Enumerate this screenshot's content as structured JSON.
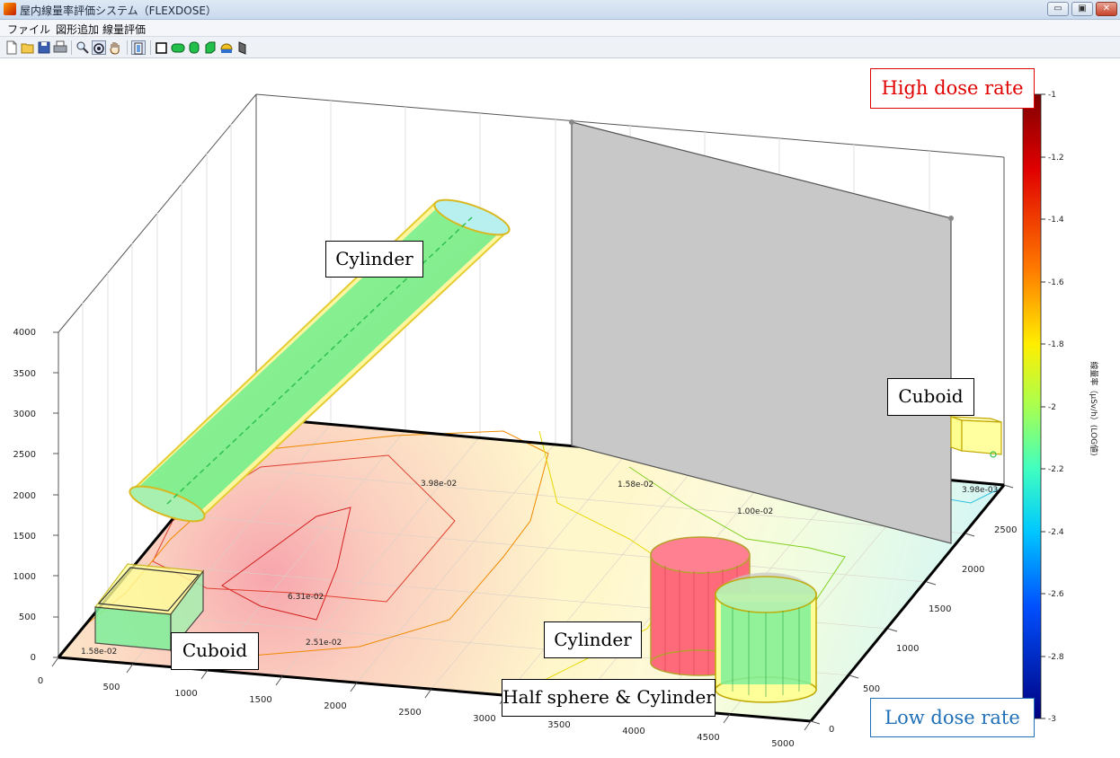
{
  "window": {
    "title": "屋内線量率評価システム（FLEXDOSE）",
    "minimize_glyph": "▭",
    "maximize_glyph": "▣",
    "close_glyph": "✕"
  },
  "menu": {
    "items": [
      "ファイル",
      "図形追加",
      "線量評価"
    ]
  },
  "toolbar": {
    "icons": [
      "new-file-icon",
      "open-folder-icon",
      "save-icon",
      "print-icon",
      "zoom-icon",
      "rotate-3d-icon",
      "pan-hand-icon",
      "legend-toggle-icon",
      "add-cuboid-icon",
      "add-cylinder-icon",
      "add-cylinder-alt-icon",
      "add-cylinder-vertical-icon",
      "add-half-sphere-icon",
      "add-wall-icon"
    ]
  },
  "annotations": {
    "cylinder_top": "Cylinder",
    "cuboid_right": "Cuboid",
    "cuboid_left": "Cuboid",
    "cylinder_bottom": "Cylinder",
    "half_sphere_cylinder": "Half sphere & Cylinder",
    "high_dose": "High dose rate",
    "low_dose": "Low dose rate"
  },
  "axes": {
    "z_ticks": [
      "0",
      "500",
      "1000",
      "1500",
      "2000",
      "2500",
      "3000",
      "3500",
      "4000"
    ],
    "x_ticks": [
      "0",
      "500",
      "1000",
      "1500",
      "2000",
      "2500",
      "3000",
      "3500",
      "4000",
      "4500",
      "5000"
    ],
    "y_ticks": [
      "0",
      "500",
      "1000",
      "1500",
      "2000",
      "2500"
    ]
  },
  "contours": {
    "labels": [
      "6.31e-02",
      "3.98e-02",
      "2.51e-02",
      "1.58e-02",
      "1.58e-02",
      "1.00e-02",
      "3.98e-03"
    ]
  },
  "colorbar": {
    "ticks": [
      "-1",
      "-1.2",
      "-1.4",
      "-1.6",
      "-1.8",
      "-2",
      "-2.2",
      "-2.4",
      "-2.6",
      "-2.8",
      "-3"
    ],
    "label": "線量率（μSv/h）(LOG値)"
  },
  "colors": {
    "high_dose": "#e00000",
    "low_dose": "#2070b8",
    "cylinder_green": "#66ee88",
    "cylinder_red": "#ff6a7a",
    "wall_gray": "#c8c8c8",
    "cuboid_yellow": "#ffff99"
  }
}
